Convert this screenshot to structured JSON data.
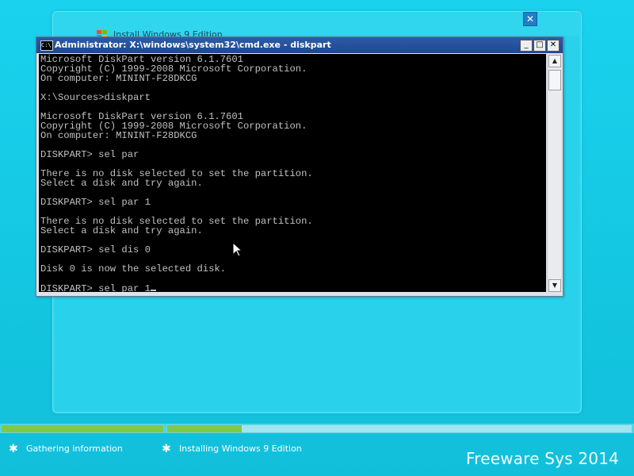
{
  "setup_window": {
    "title": "Install Windows 9 Edition",
    "close_label": "✕"
  },
  "cmd_window": {
    "title": "Administrator: X:\\windows\\system32\\cmd.exe - diskpart",
    "icon_label": "C:\\",
    "minimize_label": "_",
    "maximize_label": "□",
    "close_label": "✕",
    "console_lines": [
      "Microsoft DiskPart version 6.1.7601",
      "Copyright (C) 1999-2008 Microsoft Corporation.",
      "On computer: MININT-F28DKCG",
      "",
      "X:\\Sources>diskpart",
      "",
      "Microsoft DiskPart version 6.1.7601",
      "Copyright (C) 1999-2008 Microsoft Corporation.",
      "On computer: MININT-F28DKCG",
      "",
      "DISKPART> sel par",
      "",
      "There is no disk selected to set the partition.",
      "Select a disk and try again.",
      "",
      "DISKPART> sel par 1",
      "",
      "There is no disk selected to set the partition.",
      "Select a disk and try again.",
      "",
      "DISKPART> sel dis 0",
      "",
      "Disk 0 is now the selected disk.",
      ""
    ],
    "current_input": "DISKPART> sel par 1"
  },
  "progress": {
    "step1_fill": 1.0,
    "step2_fill": 0.16
  },
  "steps": [
    {
      "label": "Gathering information"
    },
    {
      "label": "Installing Windows 9 Edition"
    }
  ],
  "watermark": "Freeware Sys 2014",
  "colors": {
    "desktop": "#18cbe4",
    "progress_fill": "#7fc84a",
    "cmd_title_bar": "#1e4891"
  }
}
